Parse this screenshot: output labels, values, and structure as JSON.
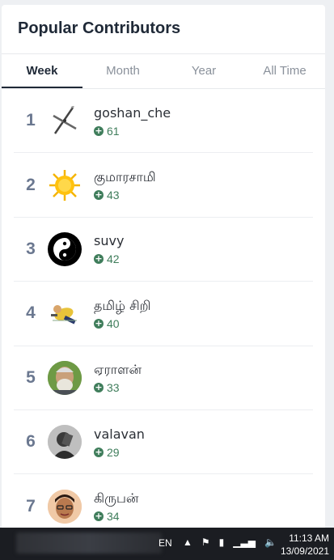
{
  "card": {
    "title": "Popular Contributors",
    "tabs": [
      {
        "label": "Week",
        "active": true
      },
      {
        "label": "Month",
        "active": false
      },
      {
        "label": "Year",
        "active": false
      },
      {
        "label": "All Time",
        "active": false
      }
    ]
  },
  "contributors": [
    {
      "rank": "1",
      "name": "goshan_che",
      "rep": "61",
      "avatar": "crossed-pens-icon"
    },
    {
      "rank": "2",
      "name": "குமாரசாமி",
      "rep": "43",
      "avatar": "sun-icon"
    },
    {
      "rank": "3",
      "name": "suvy",
      "rep": "42",
      "avatar": "yin-yang-icon"
    },
    {
      "rank": "4",
      "name": "தமிழ் சிறி",
      "rep": "40",
      "avatar": "cartoon-figure-avatar"
    },
    {
      "rank": "5",
      "name": "ஏராளன்",
      "rep": "33",
      "avatar": "old-man-photo-avatar"
    },
    {
      "rank": "6",
      "name": "valavan",
      "rep": "29",
      "avatar": "man-photo-avatar"
    },
    {
      "rank": "7",
      "name": "கிருபன்",
      "rep": "34",
      "avatar": "boy-photo-avatar"
    }
  ],
  "taskbar": {
    "language": "EN",
    "time": "11:13 AM",
    "date": "13/09/2021"
  },
  "colors": {
    "accent_green": "#3f7d5b",
    "rank_gray": "#6b7890"
  }
}
